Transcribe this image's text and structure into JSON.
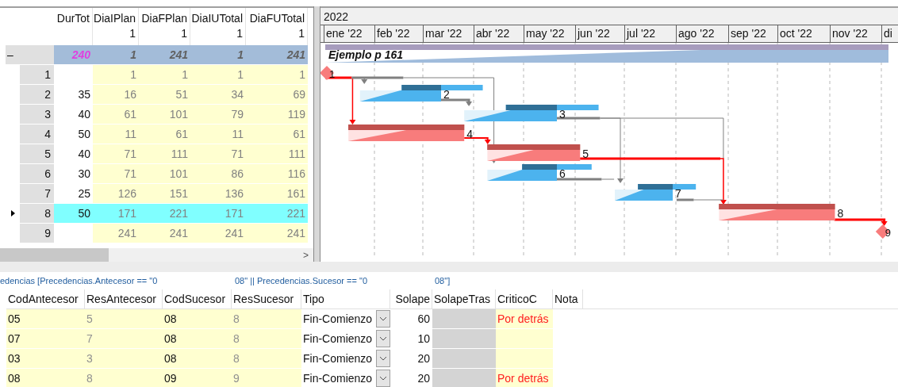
{
  "grid": {
    "columns": [
      {
        "name": "DurTot"
      },
      {
        "name": "DiaIPlan",
        "unit": "1"
      },
      {
        "name": "DiaFPlan",
        "unit": "1"
      },
      {
        "name": "DiaIUTotal",
        "unit": "1"
      },
      {
        "name": "DiaFUTotal",
        "unit": "1"
      }
    ],
    "summary": {
      "toggle": "–",
      "values": [
        "240",
        "1",
        "241",
        "1",
        "241"
      ],
      "title": "Ejemplo p 161"
    },
    "rows": [
      {
        "num": "1",
        "bar_label": "1",
        "kind": "milestone",
        "critical": true,
        "selected": false,
        "values": [
          "1",
          "1",
          "1",
          "1"
        ]
      },
      {
        "num": "2",
        "bar_label": "2",
        "kind": "task",
        "critical": false,
        "selected": false,
        "dur": "35",
        "values": [
          "16",
          "51",
          "34",
          "69"
        ]
      },
      {
        "num": "3",
        "bar_label": "3",
        "kind": "task",
        "critical": false,
        "selected": false,
        "dur": "40",
        "values": [
          "61",
          "101",
          "79",
          "119"
        ]
      },
      {
        "num": "4",
        "bar_label": "4",
        "kind": "task",
        "critical": true,
        "selected": false,
        "dur": "50",
        "values": [
          "11",
          "61",
          "11",
          "61"
        ]
      },
      {
        "num": "5",
        "bar_label": "5",
        "kind": "task",
        "critical": true,
        "selected": false,
        "dur": "40",
        "values": [
          "71",
          "111",
          "71",
          "111"
        ]
      },
      {
        "num": "6",
        "bar_label": "6",
        "kind": "task",
        "critical": false,
        "selected": false,
        "dur": "30",
        "values": [
          "71",
          "101",
          "86",
          "116"
        ]
      },
      {
        "num": "7",
        "bar_label": "7",
        "kind": "task",
        "critical": false,
        "selected": false,
        "dur": "25",
        "values": [
          "126",
          "151",
          "136",
          "161"
        ]
      },
      {
        "num": "8",
        "bar_label": "8",
        "kind": "task",
        "critical": true,
        "selected": true,
        "dur": "50",
        "values": [
          "171",
          "221",
          "171",
          "221"
        ]
      },
      {
        "num": "9",
        "bar_label": "9",
        "kind": "milestone",
        "critical": true,
        "selected": false,
        "values": [
          "241",
          "241",
          "241",
          "241"
        ]
      }
    ],
    "scroll_arrow": ">"
  },
  "timeline": {
    "year": "2022",
    "months": [
      "ene '22",
      "feb '22",
      "mar '22",
      "abr '22",
      "may '22",
      "jun '22",
      "jul '22",
      "ago '22",
      "sep '22",
      "oct '22",
      "nov '22",
      "di"
    ]
  },
  "precedences": {
    "filter_parts": [
      "edencias [Precedencias.Antecesor == \"0",
      "08\" || Precedencias.Sucesor == \"0",
      "08\"]"
    ],
    "columns": [
      "CodAntecesor",
      "ResAntecesor",
      "CodSucesor",
      "ResSucesor",
      "Tipo",
      "Solape",
      "SolapeTras",
      "CriticoC",
      "Nota"
    ],
    "rows": [
      {
        "cod_ant": "05",
        "res_ant": "5",
        "cod_suc": "08",
        "res_suc": "8",
        "tipo": "Fin-Comienzo",
        "solape": "60",
        "critico": "Por detrás"
      },
      {
        "cod_ant": "07",
        "res_ant": "7",
        "cod_suc": "08",
        "res_suc": "8",
        "tipo": "Fin-Comienzo",
        "solape": "10"
      },
      {
        "cod_ant": "03",
        "res_ant": "3",
        "cod_suc": "08",
        "res_suc": "8",
        "tipo": "Fin-Comienzo",
        "solape": "20"
      },
      {
        "cod_ant": "08",
        "res_ant": "8",
        "cod_suc": "09",
        "res_suc": "9",
        "tipo": "Fin-Comienzo",
        "solape": "20",
        "critico": "Por detrás"
      }
    ]
  }
}
